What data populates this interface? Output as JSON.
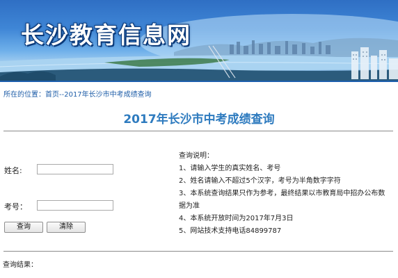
{
  "header": {
    "site_title": "长沙教育信息网"
  },
  "breadcrumb": {
    "prefix": "所在的位置：",
    "home": "首页",
    "separator": "--",
    "current": "2017年长沙市中考成绩查询"
  },
  "page_title": "2017年长沙市中考成绩查询",
  "form": {
    "name_label": "姓名:",
    "name_value": "",
    "exam_no_label": "考号：",
    "exam_no_value": "",
    "query_button": "查询",
    "clear_button": "清除"
  },
  "instructions": {
    "title": "查询说明：",
    "items": [
      "1、请输入学生的真实姓名、考号",
      "2、姓名请输入不超过5个汉字，考号为半角数字字符",
      "3、本系统查询结果只作为参考，最终结果以市教育局中招办公布数据为准",
      "4、本系统开放时间为2017年7月3日",
      "5、网站技术支持电话84899787"
    ]
  },
  "result": {
    "label": "查询结果："
  },
  "colors": {
    "title_blue": "#2e7bbf",
    "link_blue": "#1f5ea8",
    "banner_blue": "#2f6fc4"
  }
}
